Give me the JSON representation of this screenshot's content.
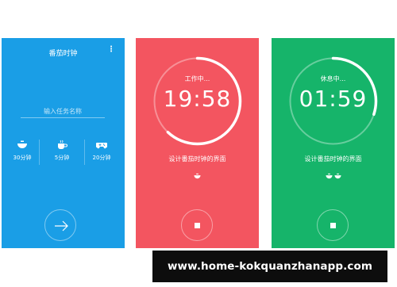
{
  "colors": {
    "blue": "#1a9ee6",
    "red": "#f35560",
    "green": "#16b46a"
  },
  "panel_setup": {
    "title": "番茄时钟",
    "menu_icon": "more-vertical-icon",
    "task_placeholder": "输入任务名称",
    "durations": [
      {
        "icon": "bowl-icon",
        "label": "30分钟"
      },
      {
        "icon": "coffee-icon",
        "label": "5分钟"
      },
      {
        "icon": "gamepad-icon",
        "label": "20分钟"
      }
    ],
    "start_icon": "arrow-right-icon"
  },
  "panel_work": {
    "state": "工作中...",
    "time": "19:58",
    "progress": 0.62,
    "caption": "设计番茄时钟的界面",
    "bowls": 1,
    "stop_icon": "stop-icon"
  },
  "panel_rest": {
    "state": "休息中...",
    "time": "01:59",
    "progress": 0.3,
    "caption": "设计番茄时钟的界面",
    "bowls": 2,
    "stop_icon": "stop-icon"
  },
  "watermark": "www.home-kokquanzhanapp.com"
}
